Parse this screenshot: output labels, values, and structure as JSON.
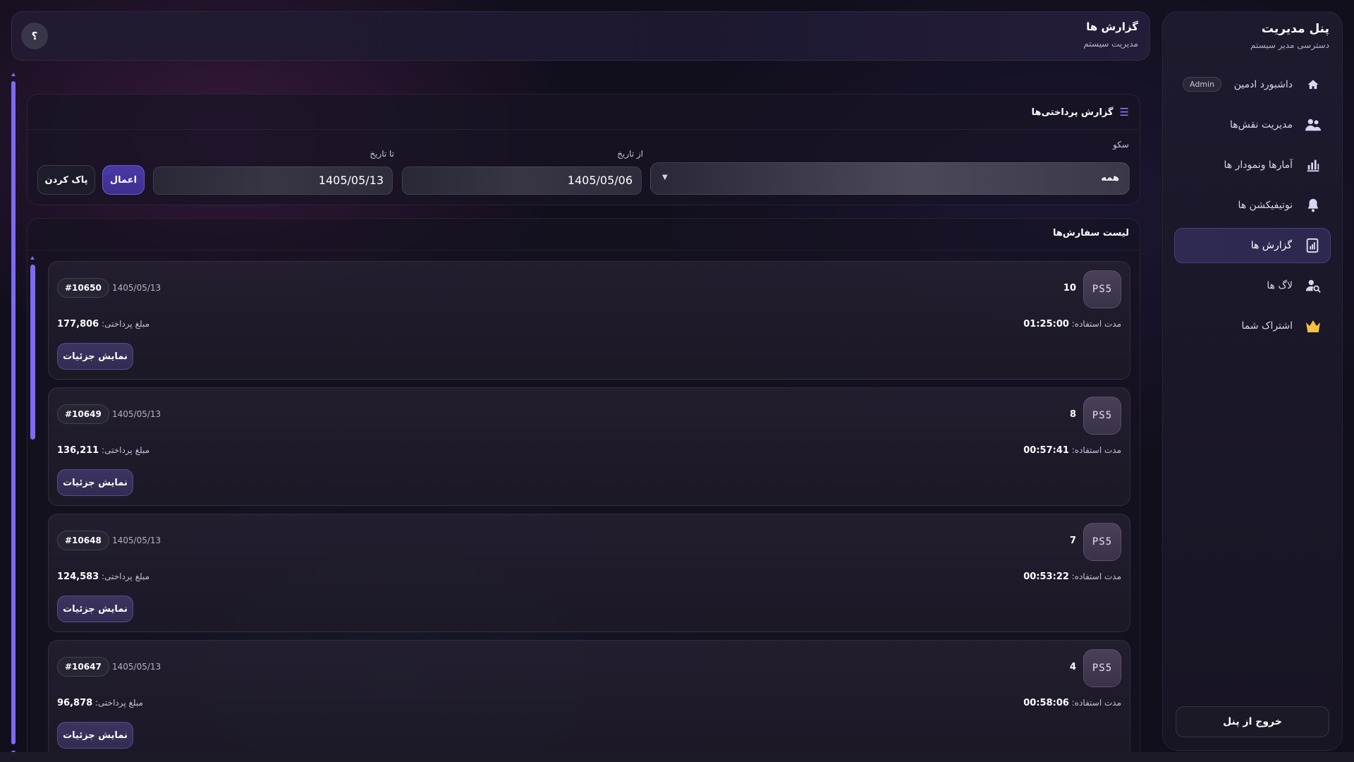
{
  "sidebar": {
    "title": "پنل مدیریت",
    "subtitle": "دسترسی مدیر سیستم",
    "items": [
      {
        "label": "داشبورد ادمین",
        "icon": "home-icon",
        "badge": "Admin"
      },
      {
        "label": "مدیریت نقش‌ها",
        "icon": "users-icon"
      },
      {
        "label": "آمارها ونمودار ها",
        "icon": "chart-icon"
      },
      {
        "label": "نوتیفیکشن ها",
        "icon": "bell-icon"
      },
      {
        "label": "گزارش ها",
        "icon": "report-icon",
        "active": true
      },
      {
        "label": "لاگ ها",
        "icon": "user-search-icon"
      },
      {
        "label": "اشتراک شما",
        "icon": "crown-icon"
      }
    ],
    "logout_label": "خروج از پنل"
  },
  "header": {
    "title": "گزارش ها",
    "subtitle": "مدیریت سیستم",
    "help_label": "؟"
  },
  "filters": {
    "title": "گزارش پرداختی‌ها",
    "station_label": "سکو",
    "station_value": "همه",
    "from_label": "از تاریخ",
    "from_value": "1405/05/06",
    "to_label": "تا تاریخ",
    "to_value": "1405/05/13",
    "apply_label": "اعمال",
    "clear_label": "پاک کردن"
  },
  "orders": {
    "title": "لیست سفارش‌ها",
    "duration_label": "مدت استفاده:",
    "payment_label": "مبلغ پرداختی:",
    "details_label": "نمایش جزئیات",
    "device_label": "PS5",
    "items": [
      {
        "station": "10",
        "id": "#10650",
        "date": "1405/05/13",
        "duration": "01:25:00",
        "amount": "177,806"
      },
      {
        "station": "8",
        "id": "#10649",
        "date": "1405/05/13",
        "duration": "00:57:41",
        "amount": "136,211"
      },
      {
        "station": "7",
        "id": "#10648",
        "date": "1405/05/13",
        "duration": "00:53:22",
        "amount": "124,583"
      },
      {
        "station": "4",
        "id": "#10647",
        "date": "1405/05/13",
        "duration": "00:58:06",
        "amount": "96,878"
      }
    ]
  },
  "colors": {
    "accent": "#7d6af5",
    "active_nav": "#2e2a52",
    "background": "#120f1d",
    "crown": "#f5c242"
  }
}
